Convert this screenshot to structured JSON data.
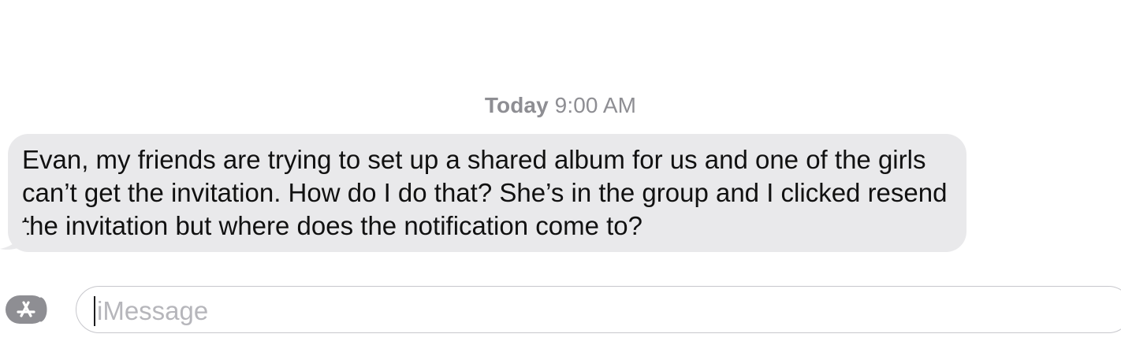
{
  "timestamp": {
    "day": "Today",
    "time": "9:00 AM"
  },
  "messages": [
    {
      "direction": "incoming",
      "text": "Evan, my friends are trying to set up a shared album for us and one of the girls can’t get the invitation. How do I do that? She’s in the group and I clicked resend the invitation but where does the notification come to?"
    }
  ],
  "composer": {
    "placeholder": "iMessage",
    "apps_icon": "app-store-icon"
  },
  "colors": {
    "incoming_bubble": "#e9e9eb",
    "timestamp_text": "#8e8e93",
    "placeholder_text": "#b6b6bb",
    "apps_button": "#8e8e93"
  }
}
